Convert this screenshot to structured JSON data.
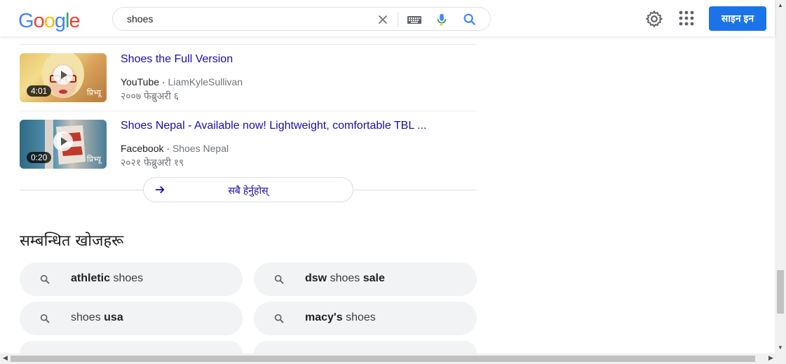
{
  "header": {
    "logo": {
      "letters": [
        "G",
        "o",
        "o",
        "g",
        "l",
        "e"
      ],
      "colors": [
        "#4285f4",
        "#ea4335",
        "#fbbc05",
        "#4285f4",
        "#34a853",
        "#ea4335"
      ]
    },
    "search": {
      "value": "shoes"
    },
    "signin_label": "साइन इन",
    "accent": "#1a73e8"
  },
  "videos": [
    {
      "title": "Shoes the Full Version",
      "source": "YouTube",
      "channel": "LiamKyleSullivan",
      "date": "२००७ फेब्रुअरी ६",
      "duration": "4:01",
      "preview": "प्रिभ्यू"
    },
    {
      "title": "Shoes Nepal - Available now! Lightweight, comfortable TBL ...",
      "source": "Facebook",
      "channel": "Shoes Nepal",
      "date": "२०२१ फेब्रुअरी १९",
      "duration": "0:20",
      "preview": "प्रिभ्यू"
    }
  ],
  "see_all_label": "सबै हेर्नुहोस्",
  "related": {
    "title": "सम्बन्धित खोजहरू",
    "items": [
      {
        "parts": [
          {
            "t": "athletic",
            "b": true
          },
          {
            "t": " shoes",
            "b": false
          }
        ]
      },
      {
        "parts": [
          {
            "t": "dsw",
            "b": true
          },
          {
            "t": " shoes ",
            "b": false
          },
          {
            "t": "sale",
            "b": true
          }
        ]
      },
      {
        "parts": [
          {
            "t": "shoes ",
            "b": false
          },
          {
            "t": "usa",
            "b": true
          }
        ]
      },
      {
        "parts": [
          {
            "t": "macy's",
            "b": true
          },
          {
            "t": " shoes",
            "b": false
          }
        ]
      }
    ]
  }
}
